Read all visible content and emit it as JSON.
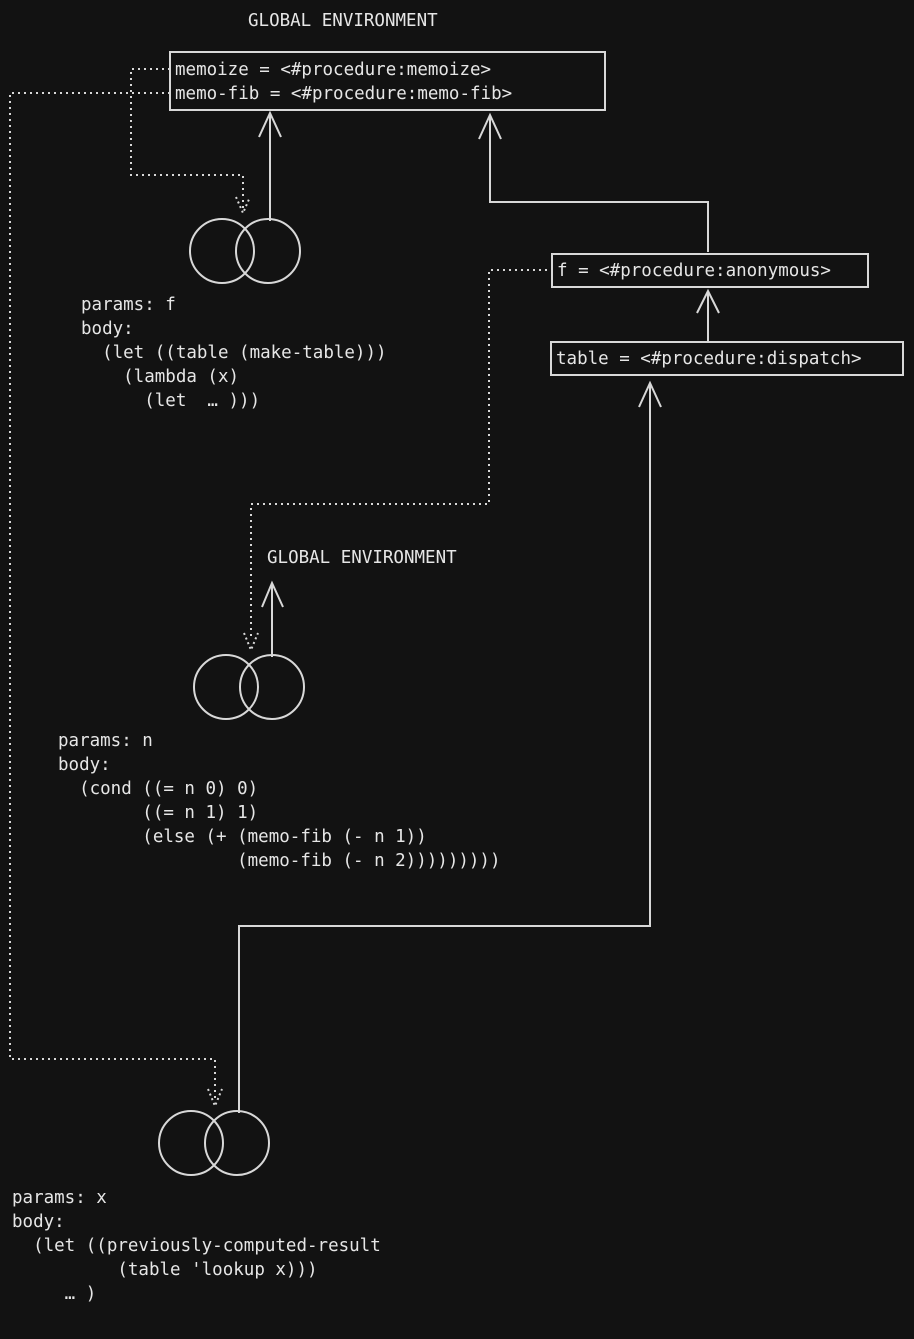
{
  "global_env_label_top": "GLOBAL ENVIRONMENT",
  "global_env_label_mid": "GLOBAL ENVIRONMENT",
  "global_frame": {
    "bindings": [
      "memoize = <#procedure:memoize>",
      "memo-fib = <#procedure:memo-fib>"
    ]
  },
  "frame_f": {
    "binding": "f = <#procedure:anonymous>"
  },
  "frame_table": {
    "binding": "table = <#procedure:dispatch>"
  },
  "procedure_memoize": {
    "code": "params: f\nbody:\n  (let ((table (make-table)))\n    (lambda (x)\n      (let  … )))"
  },
  "procedure_fib": {
    "code": "params: n\nbody:\n  (cond ((= n 0) 0)\n        ((= n 1) 1)\n        (else (+ (memo-fib (- n 1))\n                 (memo-fib (- n 2)))))))))"
  },
  "procedure_anonymous": {
    "code": "params: x\nbody:\n  (let ((previously-computed-result\n          (table 'lookup x)))\n     … )"
  },
  "colors": {
    "background": "#121212",
    "foreground": "#e6e6e6",
    "line": "#d8d8d8"
  }
}
